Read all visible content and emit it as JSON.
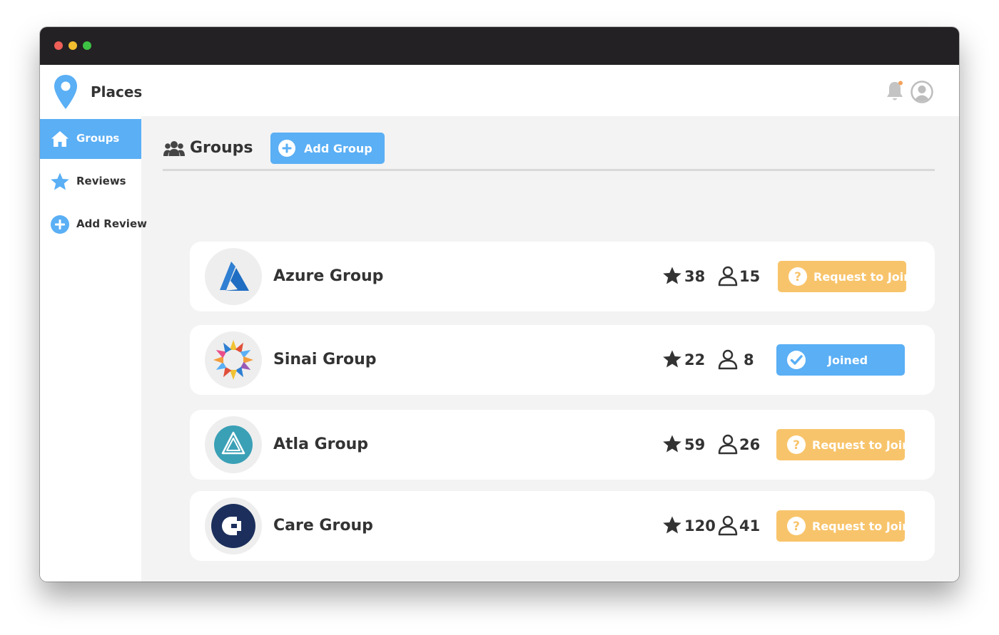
{
  "app": {
    "name": "Places"
  },
  "sidebar": {
    "items": [
      {
        "label": "Groups",
        "icon": "home-icon",
        "active": true
      },
      {
        "label": "Reviews",
        "icon": "star-icon",
        "active": false
      },
      {
        "label": "Add Review",
        "icon": "plus-circle-icon",
        "active": false
      }
    ]
  },
  "header": {
    "notification_icon": "bell-icon",
    "avatar_icon": "user-avatar-icon",
    "notification_count": ""
  },
  "main": {
    "title": "Groups",
    "title_icon": "users-icon",
    "add_button_label": "Add Group"
  },
  "groups": [
    {
      "name": "Azure Group",
      "rating": "38",
      "members": "15",
      "action": "Request to Join",
      "status": "request",
      "logo": "azure-logo"
    },
    {
      "name": "Sinai Group",
      "rating": "22",
      "members": "8",
      "action": "Joined",
      "status": "joined",
      "logo": "sinai-logo"
    },
    {
      "name": "Atla Group",
      "rating": "59",
      "members": "26",
      "action": "Request to Join",
      "status": "request",
      "logo": "atla-logo"
    },
    {
      "name": "Care Group",
      "rating": "120",
      "members": "41",
      "action": "Request to Join",
      "status": "request",
      "logo": "care-logo"
    }
  ],
  "colors": {
    "accent_blue": "#5aaff5",
    "request_orange": "#f8c46b",
    "titlebar": "#242124",
    "background": "#f3f3f3"
  }
}
